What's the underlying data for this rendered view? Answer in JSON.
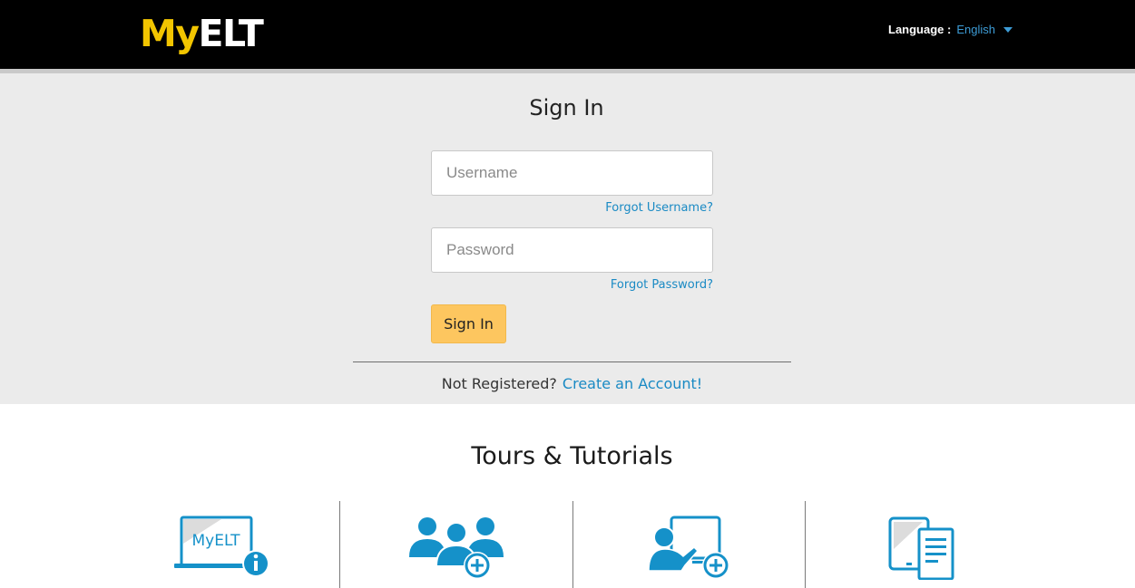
{
  "header": {
    "logo_my": "My",
    "logo_elt": "ELT",
    "language_label": "Language :",
    "language_value": "English"
  },
  "signin": {
    "title": "Sign In",
    "username_placeholder": "Username",
    "password_placeholder": "Password",
    "forgot_username": "Forgot Username?",
    "forgot_password": "Forgot Password?",
    "signin_button": "Sign In",
    "not_registered": "Not Registered?",
    "create_account": "Create an Account!"
  },
  "tours": {
    "title": "Tours & Tutorials",
    "tiles": [
      {
        "icon": "myelt-info-icon",
        "label": "MyELT"
      },
      {
        "icon": "add-group-icon"
      },
      {
        "icon": "add-class-icon"
      },
      {
        "icon": "devices-icon"
      }
    ]
  },
  "colors": {
    "brand_yellow": "#f2c500",
    "link_blue": "#1a8ac4",
    "button_yellow": "#fdc65f",
    "icon_blue": "#1591c9"
  }
}
